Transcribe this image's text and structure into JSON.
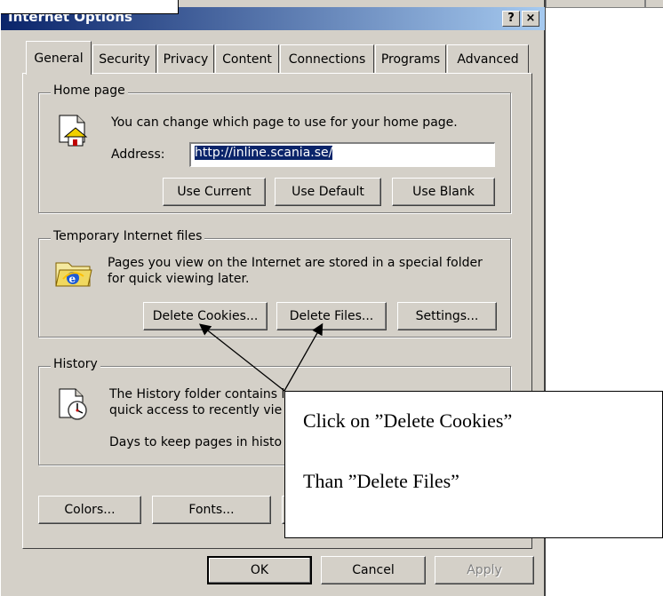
{
  "window": {
    "title": "Internet Options",
    "help_label": "?",
    "close_label": "×"
  },
  "tabs": [
    {
      "label": "General"
    },
    {
      "label": "Security"
    },
    {
      "label": "Privacy"
    },
    {
      "label": "Content"
    },
    {
      "label": "Connections"
    },
    {
      "label": "Programs"
    },
    {
      "label": "Advanced"
    }
  ],
  "home_page": {
    "legend": "Home page",
    "description": "You can change which page to use for your home page.",
    "address_label": "Address:",
    "address_value": "http://inline.scania.se/",
    "icon": "home-page-icon",
    "buttons": {
      "use_current": "Use Current",
      "use_default": "Use Default",
      "use_blank": "Use Blank"
    }
  },
  "temp_files": {
    "legend": "Temporary Internet files",
    "line1": "Pages you view on the Internet are stored in a special folder",
    "line2": "for quick viewing later.",
    "icon": "ie-folder-icon",
    "buttons": {
      "delete_cookies": "Delete Cookies...",
      "delete_files": "Delete Files...",
      "settings": "Settings..."
    }
  },
  "history": {
    "legend": "History",
    "line1": "The History folder contains l",
    "line2": "quick access to recently vie",
    "days_label": "Days to keep pages in histo",
    "icon": "history-icon"
  },
  "bottom_row": {
    "colors": "Colors...",
    "fonts": "Fonts..."
  },
  "footer": {
    "ok": "OK",
    "cancel": "Cancel",
    "apply": "Apply"
  },
  "callout": {
    "line1": "Click on ”Delete Cookies”",
    "line2": "Than ”Delete Files”"
  },
  "colors": {
    "titlebar_start": "#0a246a",
    "titlebar_end": "#a6caf0",
    "dialog_bg": "#d4d0c8"
  }
}
